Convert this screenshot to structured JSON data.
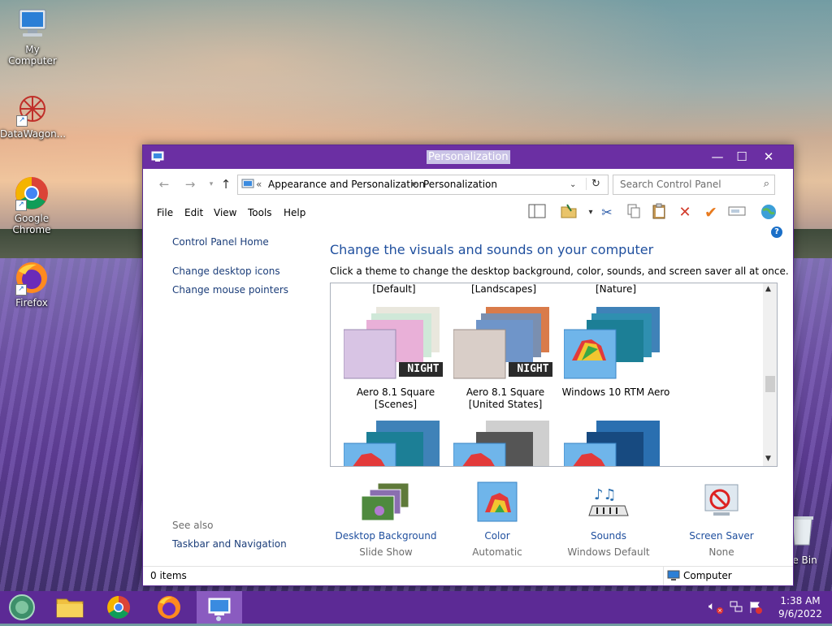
{
  "desktop": {
    "icons": [
      {
        "label": "My Computer",
        "icon": "my-computer-icon"
      },
      {
        "label": "DataWagon...",
        "icon": "datawagon-icon"
      },
      {
        "label": "Google Chrome",
        "icon": "chrome-icon"
      },
      {
        "label": "Firefox",
        "icon": "firefox-icon"
      }
    ],
    "recycle_bin_label": "le Bin"
  },
  "window": {
    "title": "Personalization",
    "address": {
      "chevrons": "«",
      "crumbs": [
        "Appearance and Personalization",
        "Personalization"
      ]
    },
    "search_placeholder": "Search Control Panel",
    "menu": [
      "File",
      "Edit",
      "View",
      "Tools",
      "Help"
    ],
    "left_pane": {
      "home": "Control Panel Home",
      "links": [
        "Change desktop icons",
        "Change mouse pointers"
      ],
      "see_also_heading": "See also",
      "see_also_links": [
        "Taskbar and Navigation"
      ]
    },
    "content": {
      "title": "Change the visuals and sounds on your computer",
      "description": "Click a theme to change the desktop background, color, sounds, and screen saver all at once.",
      "groups": [
        "[Default]",
        "[Landscapes]",
        "[Nature]"
      ],
      "themes": [
        {
          "line1": "Aero 8.1 Square",
          "line2": "[Scenes]",
          "badge": "NIGHT"
        },
        {
          "line1": "Aero 8.1 Square",
          "line2": "[United States]",
          "badge": "NIGHT"
        },
        {
          "line1": "Windows 10 RTM Aero",
          "line2": "",
          "badge": ""
        }
      ],
      "bottom": [
        {
          "label": "Desktop Background",
          "sub": "Slide Show"
        },
        {
          "label": "Color",
          "sub": "Automatic"
        },
        {
          "label": "Sounds",
          "sub": "Windows Default"
        },
        {
          "label": "Screen Saver",
          "sub": "None"
        }
      ]
    },
    "status": {
      "items": "0 items",
      "location": "Computer"
    }
  },
  "taskbar": {
    "time": "1:38 AM",
    "date": "9/6/2022"
  },
  "colors": {
    "accent": "#6b2fa3",
    "taskbar": "#5c2a95",
    "link": "#1f4f9e"
  }
}
